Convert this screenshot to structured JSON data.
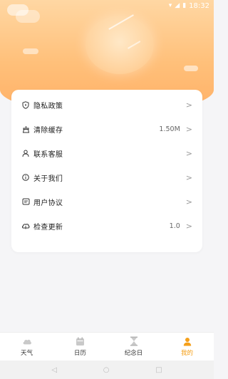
{
  "status": {
    "time": "18:32"
  },
  "menu": [
    {
      "label": "隐私政策",
      "value": "",
      "icon": "shield-icon"
    },
    {
      "label": "清除缓存",
      "value": "1.50M",
      "icon": "broom-icon"
    },
    {
      "label": "联系客服",
      "value": "",
      "icon": "person-icon"
    },
    {
      "label": "关于我们",
      "value": "",
      "icon": "info-icon"
    },
    {
      "label": "用户协议",
      "value": "",
      "icon": "document-icon"
    },
    {
      "label": "检查更新",
      "value": "1.0",
      "icon": "cloud-icon"
    }
  ],
  "chevron": ">",
  "tabs": [
    {
      "label": "天气",
      "icon": "weather-icon"
    },
    {
      "label": "日历",
      "icon": "calendar-icon"
    },
    {
      "label": "纪念日",
      "icon": "hourglass-icon"
    },
    {
      "label": "我的",
      "icon": "user-icon",
      "active": true
    }
  ],
  "colors": {
    "accent": "#f5a01a",
    "header_top": "#ffd7a3",
    "header_bottom": "#ffb066"
  }
}
